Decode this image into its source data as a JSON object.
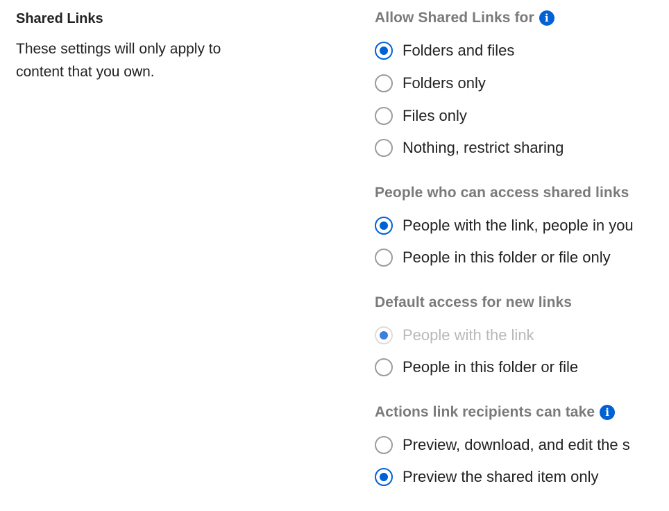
{
  "section": {
    "title": "Shared Links",
    "description": "These settings will only apply to content that you own."
  },
  "allow_shared_links": {
    "heading": "Allow Shared Links for",
    "info_icon": "info-icon",
    "options": [
      {
        "label": "Folders and files",
        "checked": true
      },
      {
        "label": "Folders only",
        "checked": false
      },
      {
        "label": "Files only",
        "checked": false
      },
      {
        "label": "Nothing, restrict sharing",
        "checked": false
      }
    ]
  },
  "people_access": {
    "heading": "People who can access shared links",
    "options": [
      {
        "label": "People with the link, people in you",
        "checked": true
      },
      {
        "label": "People in this folder or file only",
        "checked": false
      }
    ]
  },
  "default_access": {
    "heading": "Default access for new links",
    "options": [
      {
        "label": "People with the link",
        "checked": true,
        "disabled": true
      },
      {
        "label": "People in this folder or file",
        "checked": false
      }
    ]
  },
  "recipient_actions": {
    "heading": "Actions link recipients can take",
    "info_icon": "info-icon",
    "options": [
      {
        "label": "Preview, download, and edit the s",
        "checked": false
      },
      {
        "label": "Preview the shared item only",
        "checked": true
      }
    ]
  },
  "colors": {
    "accent": "#0061d5",
    "heading_gray": "#7a7a7a",
    "disabled_text": "#b9b9b9"
  }
}
